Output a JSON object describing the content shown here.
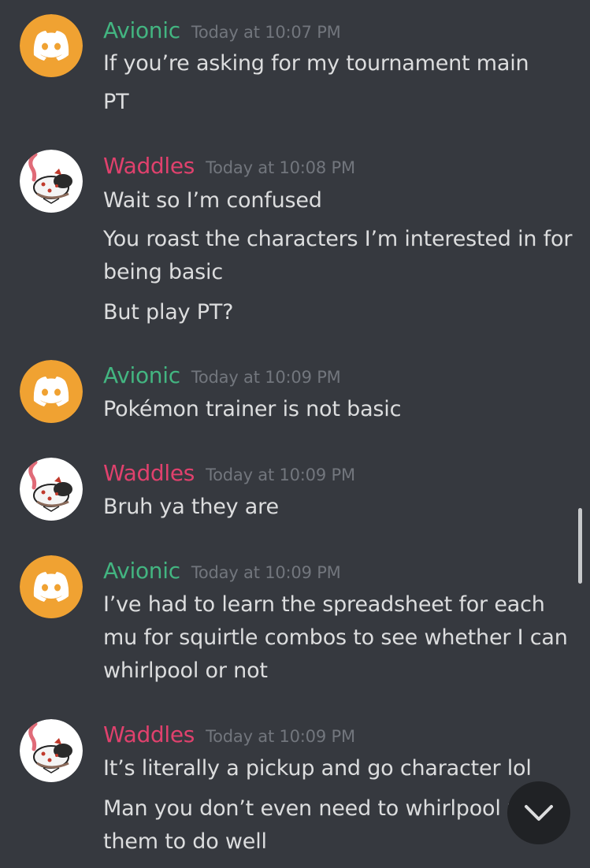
{
  "colors": {
    "background": "#36393f",
    "message_text": "#dcddde",
    "timestamp": "#72767d",
    "user_avionic": "#43b581",
    "user_waddles": "#e0416d",
    "avatar_discord_bg": "#f0a232",
    "jump_button_bg": "#202225"
  },
  "messages": [
    {
      "author": "Avionic",
      "timestamp": "Today at 10:07 PM",
      "avatar_icon": "discord-logo-icon",
      "lines": [
        "If you’re asking for my tournament main",
        "PT"
      ]
    },
    {
      "author": "Waddles",
      "timestamp": "Today at 10:08 PM",
      "avatar_icon": "pokemon-avatar-icon",
      "lines": [
        "Wait so I’m confused",
        "You roast the characters I’m interested in for",
        "being basic",
        "But play PT?"
      ]
    },
    {
      "author": "Avionic",
      "timestamp": "Today at 10:09 PM",
      "avatar_icon": "discord-logo-icon",
      "lines": [
        "Pokémon trainer is not basic"
      ]
    },
    {
      "author": "Waddles",
      "timestamp": "Today at 10:09 PM",
      "avatar_icon": "pokemon-avatar-icon",
      "lines": [
        "Bruh ya they are"
      ]
    },
    {
      "author": "Avionic",
      "timestamp": "Today at 10:09 PM",
      "avatar_icon": "discord-logo-icon",
      "lines": [
        "I’ve had to learn the spreadsheet for each",
        "mu for squirtle combos to see whether I can",
        "whirlpool or not"
      ]
    },
    {
      "author": "Waddles",
      "timestamp": "Today at 10:09 PM",
      "avatar_icon": "pokemon-avatar-icon",
      "lines": [
        "It’s literally a pickup and go character lol",
        "Man you don’t even need to whirlpool w",
        "them to do well"
      ]
    }
  ],
  "jump_button_icon": "chevron-down-icon"
}
